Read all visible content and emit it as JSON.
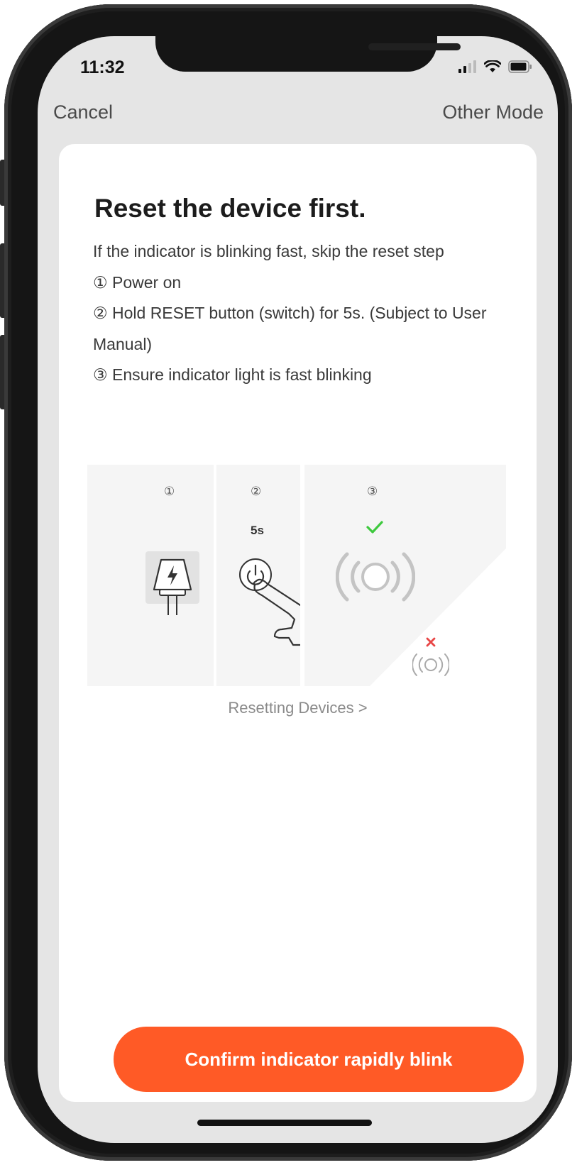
{
  "status_bar": {
    "time": "11:32",
    "icons": [
      "signal-icon",
      "wifi-icon",
      "battery-icon"
    ]
  },
  "nav": {
    "cancel_label": "Cancel",
    "other_mode_label": "Other Mode"
  },
  "main": {
    "title": "Reset the device first.",
    "instructions": [
      "If the indicator is blinking fast, skip the reset step",
      "① Power on",
      "② Hold RESET button (switch) for 5s. (Subject to User Manual)",
      "③ Ensure indicator light is fast blinking"
    ],
    "illustration": {
      "step1_num": "①",
      "step2_num": "②",
      "step2_duration": "5s",
      "step3_num": "③",
      "icons": [
        "power-plug-icon",
        "power-button-icon",
        "finger-press-icon",
        "check-icon",
        "fast-blink-indicator-icon",
        "cross-icon",
        "slow-blink-indicator-icon"
      ]
    },
    "reset_link_label": "Resetting Devices >",
    "confirm_button_label": "Confirm indicator rapidly blink"
  },
  "colors": {
    "accent": "#ff5a26",
    "check": "#3ec93e",
    "cross": "#e84545",
    "screen_bg": "#e5e5e5"
  }
}
